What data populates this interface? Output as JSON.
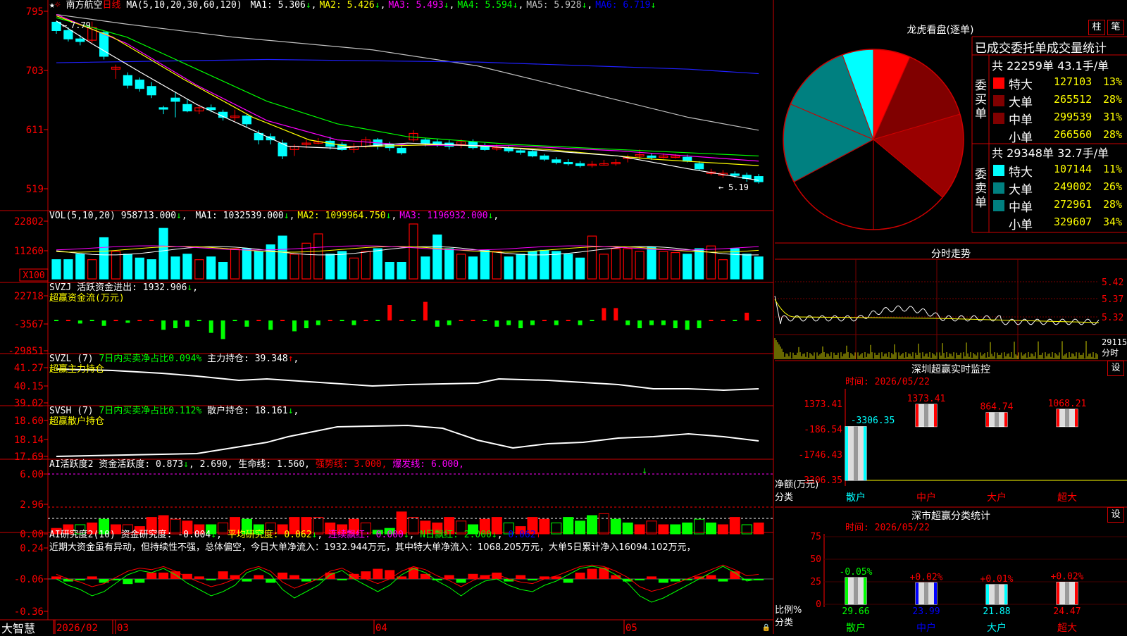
{
  "stock": {
    "name": "南方航空",
    "period": "日线"
  },
  "ma_header": {
    "label": "MA(5,10,20,30,60,120)",
    "items": [
      {
        "name": "MA1",
        "value": "5.306",
        "color": "#ffffff"
      },
      {
        "name": "MA2",
        "value": "5.426",
        "color": "#ffff00"
      },
      {
        "name": "MA3",
        "value": "5.493",
        "color": "#ff00ff"
      },
      {
        "name": "MA4",
        "value": "5.594",
        "color": "#00ff00"
      },
      {
        "name": "MA5",
        "value": "5.928",
        "color": "#c0c0c0"
      },
      {
        "name": "MA6",
        "value": "6.719",
        "color": "#0000ff"
      }
    ]
  },
  "price_panel": {
    "y_ticks": [
      "795",
      "703",
      "611",
      "519"
    ],
    "high_label": "7.79",
    "low_label": "5.19"
  },
  "vol_panel": {
    "header": "VOL(5,10,20)",
    "value": "958713.000",
    "ma": [
      {
        "name": "MA1",
        "value": "1032539.000",
        "color": "#ffffff"
      },
      {
        "name": "MA2",
        "value": "1099964.750",
        "color": "#ffff00"
      },
      {
        "name": "MA3",
        "value": "1196932.000",
        "color": "#ff00ff"
      }
    ],
    "y_ticks": [
      "22802",
      "11260"
    ],
    "unit": "X100"
  },
  "svzj_panel": {
    "header": "SVZJ",
    "label": "活跃资金进出:",
    "value": "1932.906",
    "subtitle": "超赢资金流(万元)",
    "y_ticks": [
      "22718",
      "-3567",
      "-29851"
    ]
  },
  "svzl_panel": {
    "header": "SVZL (7)",
    "label1": "7日内买卖净占比0.094%",
    "label2": "主力持仓:",
    "value": "39.348",
    "subtitle": "超赢主力持仓",
    "y_ticks": [
      "41.27",
      "40.15",
      "39.02"
    ]
  },
  "svsh_panel": {
    "header": "SVSH (7)",
    "label1": "7日内买卖净占比0.112%",
    "label2": "散户持仓:",
    "value": "18.161",
    "subtitle": "超赢散户持仓",
    "y_ticks": [
      "18.60",
      "18.14",
      "17.69"
    ]
  },
  "ai_active_panel": {
    "header": "AI活跃度2",
    "label": "资金活跃度:",
    "value1": "0.873",
    "value2": "2.690",
    "life_label": "生命线:",
    "life_value": "1.560,",
    "strong_line": "强势线: 3.000,",
    "burst_line": "爆发线: 6.000,",
    "y_ticks": [
      "6.00",
      "2.96",
      "0.00"
    ]
  },
  "ai_research_panel": {
    "header": "AI研究度2(10)",
    "label": "资金研究度:",
    "value": "-0.004",
    "avg_label": "平均研究度:",
    "avg_value": "0.062",
    "red_label": "连续飘红:",
    "red_value": "0.000",
    "n_label": "N日飘红:",
    "n_value": "2.000",
    "last_value": "0.062",
    "comment": "近期大资金虽有异动，但持续性不强，总体偏空，今日大单净流入：1932.944万元，其中特大单净流入：1068.205万元，大单5日累计净入16094.102万元，",
    "y_ticks": [
      "0.24",
      "-0.06",
      "-0.36"
    ]
  },
  "x_axis": {
    "labels": [
      "2026/02",
      "03",
      "04",
      "05"
    ],
    "brand": "大智慧"
  },
  "lhb": {
    "title": "龙虎看盘(逐单)",
    "btn1": "柱",
    "btn2": "笔",
    "stat_title": "已成交委托单成交量统计",
    "buy_label": "委买单",
    "buy_summary": "共 22259单 43.1手/单",
    "buy_rows": [
      {
        "name": "特大",
        "value": "127103",
        "pct": "13%",
        "color": "#ff0000"
      },
      {
        "name": "大单",
        "value": "265512",
        "pct": "28%",
        "color": "#800000"
      },
      {
        "name": "中单",
        "value": "299539",
        "pct": "31%",
        "color": "#800000"
      },
      {
        "name": "小单",
        "value": "266560",
        "pct": "28%",
        "color": "#000000"
      }
    ],
    "sell_label": "委卖单",
    "sell_summary": "共 29348单 32.7手/单",
    "sell_rows": [
      {
        "name": "特大",
        "value": "107144",
        "pct": "11%",
        "color": "#00ffff"
      },
      {
        "name": "大单",
        "value": "249002",
        "pct": "26%",
        "color": "#008080"
      },
      {
        "name": "中单",
        "value": "272961",
        "pct": "28%",
        "color": "#008080"
      },
      {
        "name": "小单",
        "value": "329607",
        "pct": "34%",
        "color": "#000000"
      }
    ]
  },
  "intraday": {
    "title": "分时走势",
    "y_ticks": [
      "5.42",
      "5.37",
      "5.32"
    ],
    "vol_tick": "29115",
    "vol_unit": "分时"
  },
  "sz_monitor": {
    "title": "深圳超赢实时监控",
    "gear": "设",
    "time": "时间: 2026/05/22",
    "y_ticks": [
      "1373.41",
      "-186.54",
      "-1746.43",
      "-3306.35"
    ],
    "unit_label": "净额(万元)",
    "class_label": "分类",
    "categories": [
      "散户",
      "中户",
      "大户",
      "超大"
    ],
    "bar_labels": [
      "-3306.35",
      "1373.41",
      "864.74",
      "1068.21"
    ]
  },
  "sz_class": {
    "title": "深市超赢分类统计",
    "gear": "设",
    "time": "时间: 2026/05/22",
    "y_ticks": [
      "75",
      "50",
      "25",
      "0"
    ],
    "ratio_label": "比例%",
    "class_label": "分类",
    "categories": [
      "散户",
      "中户",
      "大户",
      "超大"
    ],
    "changes": [
      "-0.05%",
      "+0.02%",
      "+0.01%",
      "+0.02%"
    ],
    "values": [
      "29.66",
      "23.99",
      "21.88",
      "24.47"
    ]
  },
  "chart_data": [
    {
      "type": "bar",
      "title": "深圳超赢实时监控",
      "categories": [
        "散户",
        "中户",
        "大户",
        "超大"
      ],
      "values": [
        -3306.35,
        1373.41,
        864.74,
        1068.21
      ],
      "ylabel": "净额(万元)"
    },
    {
      "type": "bar",
      "title": "深市超赢分类统计",
      "categories": [
        "散户",
        "中户",
        "大户",
        "超大"
      ],
      "values": [
        29.66,
        23.99,
        21.88,
        24.47
      ],
      "ylabel": "比例%",
      "ylim": [
        0,
        75
      ]
    },
    {
      "type": "pie",
      "title": "龙虎看盘(逐单)",
      "categories": [
        "委买特大",
        "委买大单",
        "委买中单",
        "委买小单",
        "委卖特大",
        "委卖大单",
        "委卖中单",
        "委卖小单"
      ],
      "values": [
        127103,
        265512,
        299539,
        266560,
        107144,
        249002,
        272961,
        329607
      ]
    }
  ]
}
